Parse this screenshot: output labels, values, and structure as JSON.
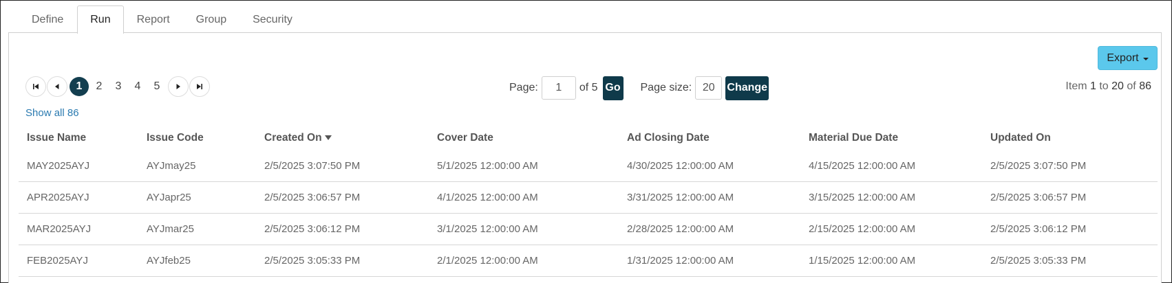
{
  "tabs": [
    {
      "label": "Define",
      "active": false
    },
    {
      "label": "Run",
      "active": true
    },
    {
      "label": "Report",
      "active": false
    },
    {
      "label": "Group",
      "active": false
    },
    {
      "label": "Security",
      "active": false
    }
  ],
  "toolbar": {
    "export_label": "Export"
  },
  "pager": {
    "pages": [
      "1",
      "2",
      "3",
      "4",
      "5"
    ],
    "current_page": "1",
    "page_label": "Page:",
    "page_value": "1",
    "of_total": "of 5",
    "go_label": "Go",
    "page_size_label": "Page size:",
    "page_size_value": "20",
    "change_label": "Change",
    "item_prefix": "Item",
    "item_from": "1",
    "item_to_word": "to",
    "item_to": "20",
    "item_of_word": "of",
    "item_total": "86",
    "show_all": "Show all 86"
  },
  "table": {
    "columns": [
      "Issue Name",
      "Issue Code",
      "Created On",
      "Cover Date",
      "Ad Closing Date",
      "Material Due Date",
      "Updated On"
    ],
    "sorted_column": "Created On",
    "sort_direction": "descending",
    "rows": [
      [
        "MAY2025AYJ",
        "AYJmay25",
        "2/5/2025 3:07:50 PM",
        "5/1/2025 12:00:00 AM",
        "4/30/2025 12:00:00 AM",
        "4/15/2025 12:00:00 AM",
        "2/5/2025 3:07:50 PM"
      ],
      [
        "APR2025AYJ",
        "AYJapr25",
        "2/5/2025 3:06:57 PM",
        "4/1/2025 12:00:00 AM",
        "3/31/2025 12:00:00 AM",
        "3/15/2025 12:00:00 AM",
        "2/5/2025 3:06:57 PM"
      ],
      [
        "MAR2025AYJ",
        "AYJmar25",
        "2/5/2025 3:06:12 PM",
        "3/1/2025 12:00:00 AM",
        "2/28/2025 12:00:00 AM",
        "2/15/2025 12:00:00 AM",
        "2/5/2025 3:06:12 PM"
      ],
      [
        "FEB2025AYJ",
        "AYJfeb25",
        "2/5/2025 3:05:33 PM",
        "2/1/2025 12:00:00 AM",
        "1/31/2025 12:00:00 AM",
        "1/15/2025 12:00:00 AM",
        "2/5/2025 3:05:33 PM"
      ]
    ]
  },
  "colors": {
    "accent_dark": "#133e4f",
    "export_button": "#5bc8ec",
    "link": "#2a7ab0"
  }
}
